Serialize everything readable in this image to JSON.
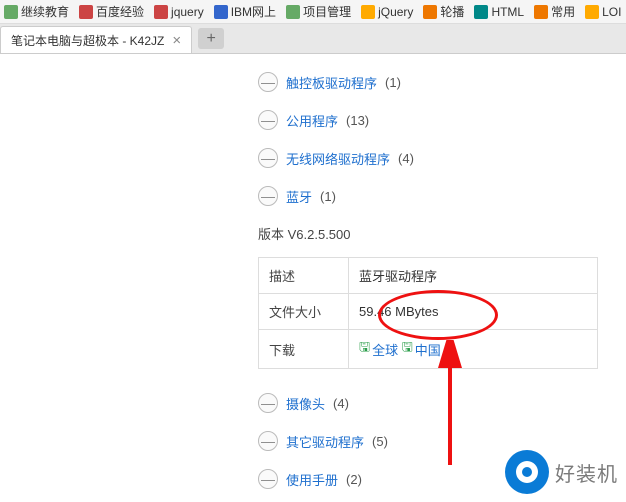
{
  "bookmarks": [
    {
      "label": "继续教育",
      "iconClass": "bm-green"
    },
    {
      "label": "百度经验",
      "iconClass": "bm-red"
    },
    {
      "label": "jquery",
      "iconClass": "bm-red"
    },
    {
      "label": "IBM网上",
      "iconClass": "bm-blue"
    },
    {
      "label": "项目管理",
      "iconClass": "bm-green"
    },
    {
      "label": "jQuery",
      "iconClass": "bm-yellow"
    },
    {
      "label": "轮播",
      "iconClass": "bm-orange"
    },
    {
      "label": "HTML",
      "iconClass": "bm-teal"
    },
    {
      "label": "常用",
      "iconClass": "bm-orange"
    },
    {
      "label": "LOI",
      "iconClass": "bm-yellow"
    }
  ],
  "tab": {
    "title": "笔记本电脑与超极本 - K42JZ"
  },
  "categories_top": [
    {
      "label": "触控板驱动程序",
      "count": "(1)"
    },
    {
      "label": "公用程序",
      "count": "(13)"
    },
    {
      "label": "无线网络驱动程序",
      "count": "(4)"
    },
    {
      "label": "蓝牙",
      "count": "(1)"
    }
  ],
  "version_line": "版本 V6.2.5.500",
  "detail": {
    "desc_label": "描述",
    "desc_value": "蓝牙驱动程序",
    "size_label": "文件大小",
    "size_value": "59.46 MBytes",
    "dl_label": "下载",
    "dl_global": "全球",
    "dl_china": "中国"
  },
  "categories_bottom": [
    {
      "label": "摄像头",
      "count": "(4)"
    },
    {
      "label": "其它驱动程序",
      "count": "(5)"
    },
    {
      "label": "使用手册",
      "count": "(2)"
    }
  ],
  "watermark": "好装机",
  "collapse_glyph": "—",
  "close_glyph": "×",
  "plus_glyph": "+",
  "save_glyph": "🖫"
}
